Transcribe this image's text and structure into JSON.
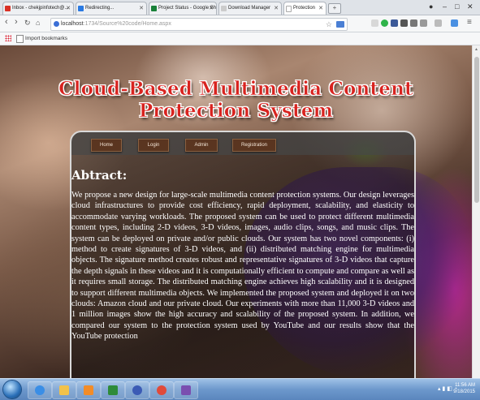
{
  "browser": {
    "tabs": [
      {
        "label": "Inbox - chekjpinfotech@...",
        "favicon_color": "#d93025"
      },
      {
        "label": "Redirecting...",
        "favicon_color": "#2a7ae2"
      },
      {
        "label": "Project Status - Google Sh",
        "favicon_color": "#188038"
      },
      {
        "label": "Download Manager",
        "favicon_color": "#cccccc"
      },
      {
        "label": "Protection",
        "favicon_color": "#ffffff"
      }
    ],
    "new_tab_symbol": "+",
    "window_controls": [
      "–",
      "□",
      "✕"
    ],
    "url_host": "localhost",
    "url_path": ":1734/Source%20code/Home.aspx",
    "bookmarks_label": "Import bookmarks"
  },
  "site": {
    "title": "Cloud-Based Multimedia Content Protection System",
    "nav": [
      {
        "label": "Home"
      },
      {
        "label": "Login"
      },
      {
        "label": "Admin"
      },
      {
        "label": "Registration"
      }
    ],
    "heading": "Abtract:",
    "abstract": "We propose a new design for large-scale multimedia content protection systems. Our design leverages cloud infrastructures to provide cost efficiency, rapid deployment, scalability, and elasticity to accommodate varying workloads. The proposed system can be used to protect different multimedia content types, including 2-D videos, 3-D videos, images, audio clips, songs, and music clips. The system can be deployed on private and/or public clouds. Our system has two novel components: (i) method to create signatures of 3-D videos, and (ii) distributed matching engine for multimedia objects. The signature method creates robust and representative signatures of 3-D videos that capture the depth signals in these videos and it is computationally efficient to compute and compare as well as it requires small storage. The distributed matching engine achieves high scalability and it is designed to support different multimedia objects. We implemented the proposed system and deployed it on two clouds: Amazon cloud and our private cloud. Our experiments with more than 11,000 3-D videos and 1 million images show the high accuracy and scalability of the proposed system. In addition, we compared our system to the protection system used by YouTube and our results show that the YouTube protection"
  },
  "taskbar": {
    "apps": [
      {
        "icon": "ie-icon",
        "color": "#3a8ee6"
      },
      {
        "icon": "folder-icon",
        "color": "#f2c24b"
      },
      {
        "icon": "media-player-icon",
        "color": "#f28c28"
      },
      {
        "icon": "excel-icon",
        "color": "#2e8b3a"
      },
      {
        "icon": "infinity-icon",
        "color": "#3b5bb5"
      },
      {
        "icon": "chrome-icon",
        "color": "#e04a3a"
      },
      {
        "icon": "visual-studio-icon",
        "color": "#7a4fb0"
      }
    ],
    "time": "11:56 AM",
    "date": "9/18/2015"
  }
}
